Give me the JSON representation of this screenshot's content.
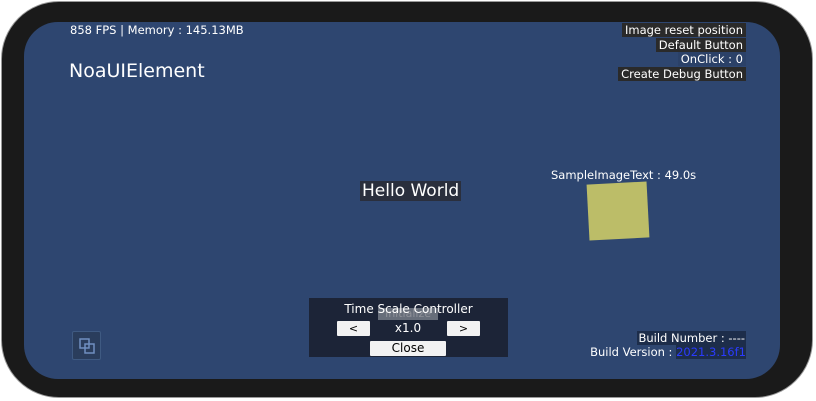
{
  "status": {
    "fps_text": "858 FPS | Memory : 145.13MB"
  },
  "app": {
    "title": "NoaUIElement"
  },
  "debug": {
    "buttons": [
      {
        "label": "Image reset position"
      },
      {
        "label": "Default Button"
      },
      {
        "label": "OnClick : 0"
      },
      {
        "label": "Create Debug Button"
      }
    ]
  },
  "hello": {
    "text": "Hello World"
  },
  "sample": {
    "text": "SampleImageText : 49.0s",
    "color": "#bcbd68"
  },
  "time_scale": {
    "title": "Time Scale Controller",
    "ghost_label": "Initialize",
    "prev_label": "<",
    "next_label": ">",
    "value": "x1.0",
    "close_label": "Close"
  },
  "build": {
    "number_text": "Build Number : ----",
    "version_label": "Build Version : ",
    "version_value": "2021.3.16f1"
  },
  "icons": {
    "corner": "copy-windows-icon"
  },
  "colors": {
    "background": "#2e4670",
    "frame": "#1a1a1a"
  }
}
